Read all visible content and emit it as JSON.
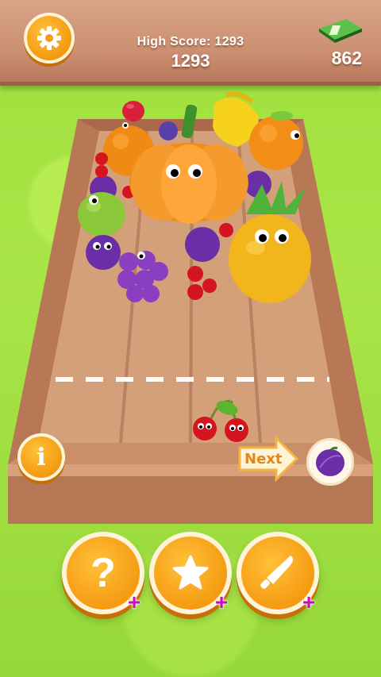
{
  "hud": {
    "high_score_label": "High Score: 1293",
    "score": "1293",
    "coins": "862"
  },
  "next": {
    "label": "Next",
    "fruit": "plum"
  },
  "icons": {
    "settings": "gear-icon",
    "info": "info-icon",
    "cash": "cash-stack-icon",
    "hint": "question-icon",
    "shake": "star-icon",
    "knife": "knife-icon",
    "plus": "+"
  },
  "power_plus": [
    "+",
    "+",
    "+"
  ],
  "info_glyph": "i",
  "hint_glyph": "?",
  "board_fruits": [
    "strawberry",
    "orange",
    "pumpkin",
    "banana",
    "orange",
    "cherry",
    "plum",
    "pear",
    "plum",
    "grapes",
    "plum",
    "cherry",
    "cherry",
    "pineapple"
  ],
  "held_fruit": "cherry",
  "colors": {
    "accent": "#f39a10",
    "topbar": "#cc9073",
    "grass": "#9ddf3d",
    "plus": "#c40fbf"
  }
}
